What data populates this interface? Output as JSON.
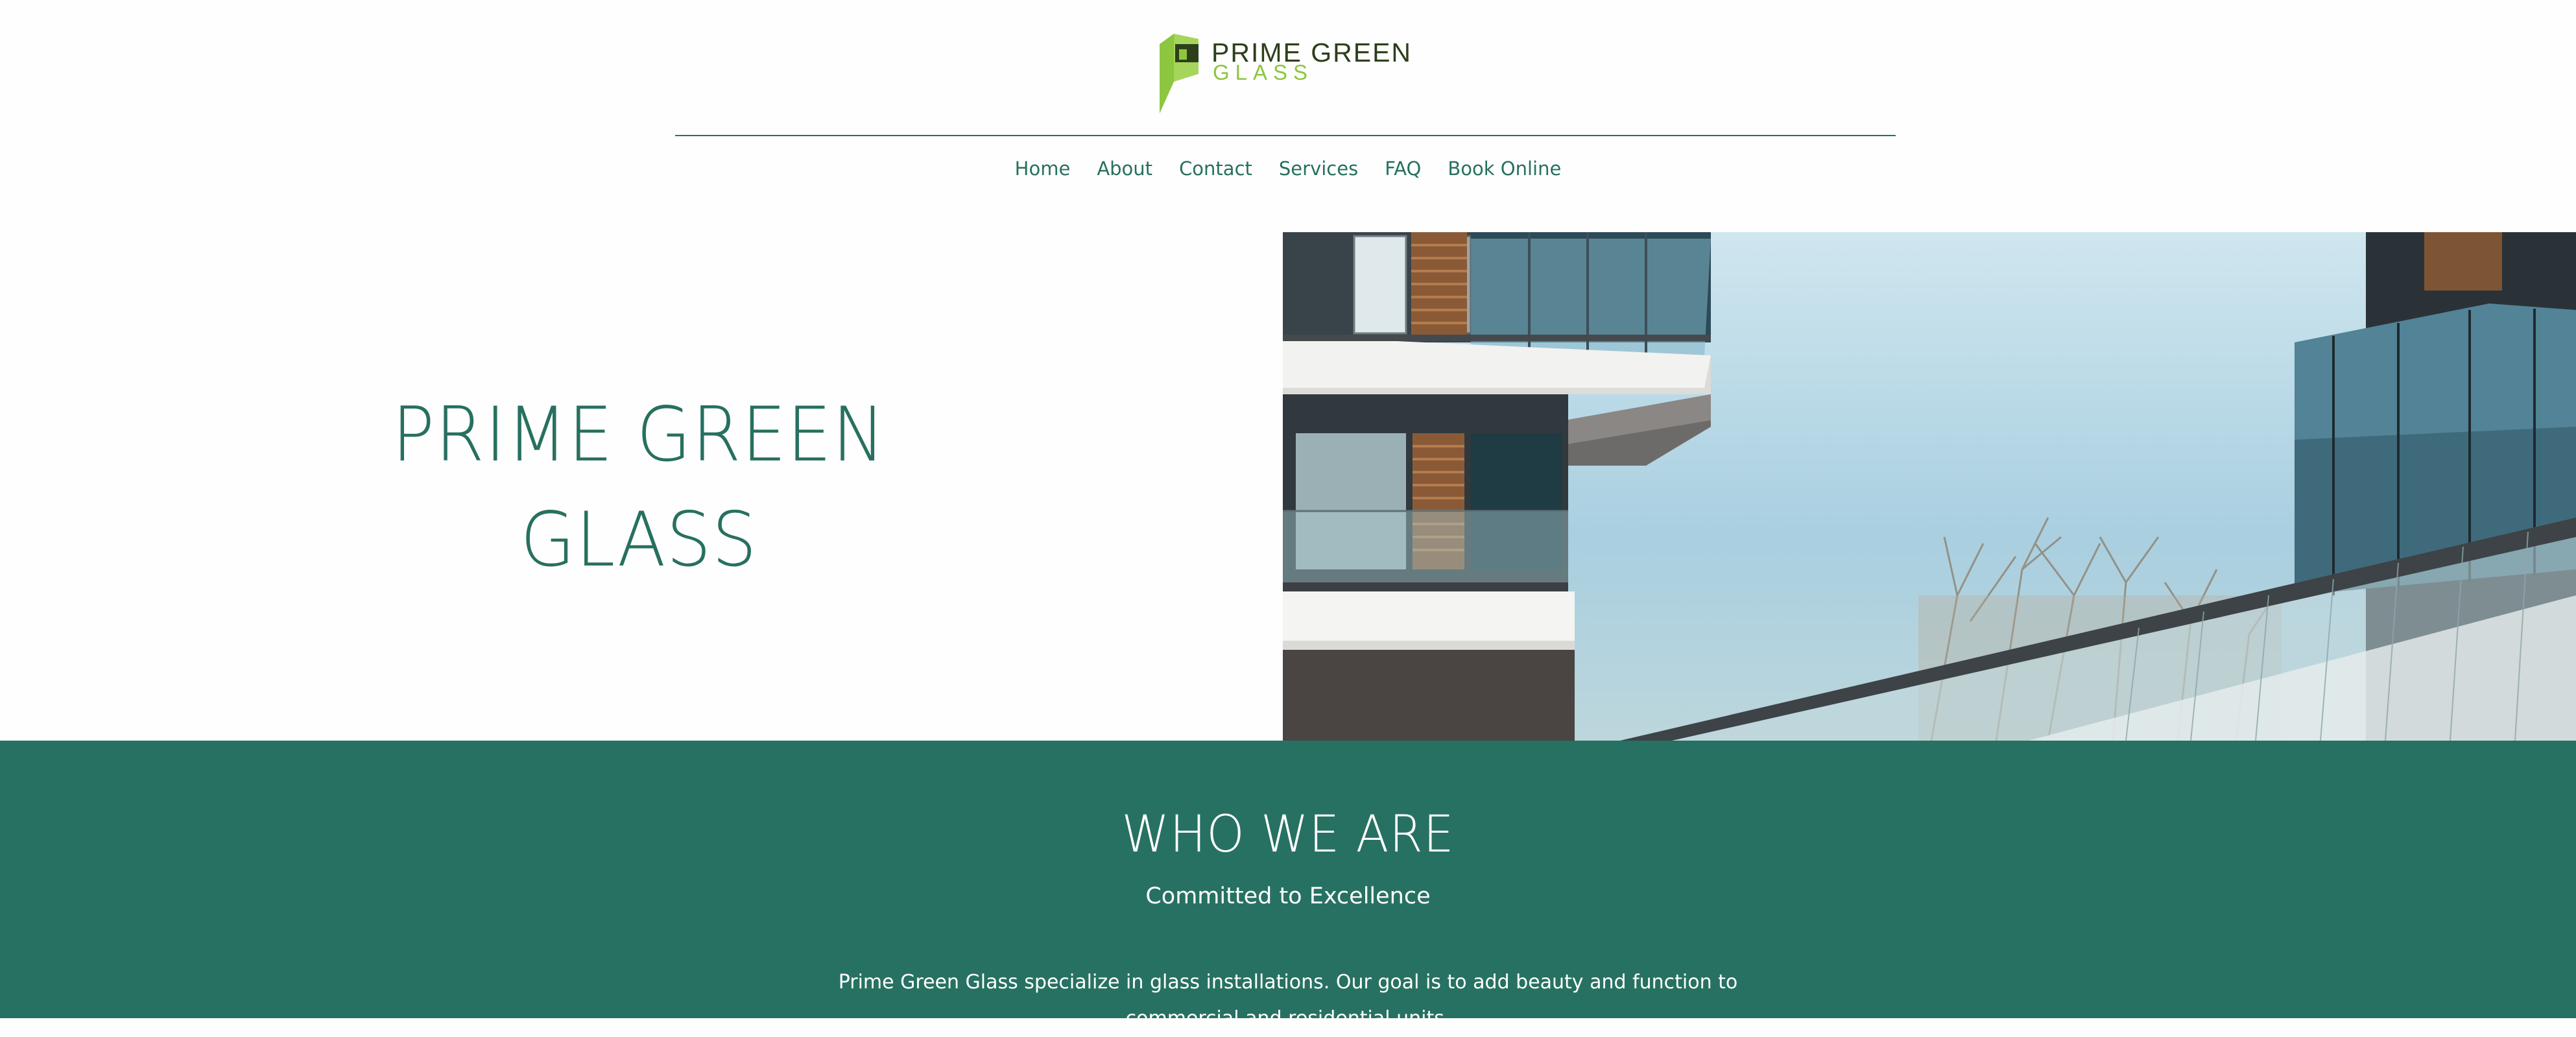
{
  "brand": {
    "line1": "PRIME GREEN",
    "line2": "GLASS",
    "colors": {
      "dark": "#2d3f1a",
      "lime": "#8dc63f",
      "teal": "#27705f"
    }
  },
  "nav": {
    "items": [
      "Home",
      "About",
      "Contact",
      "Services",
      "FAQ",
      "Book Online"
    ]
  },
  "hero": {
    "title_line1": "PRIME GREEN",
    "title_line2": "GLASS"
  },
  "who": {
    "title": "WHO WE ARE",
    "subtitle": "Committed to Excellence",
    "body": "Prime Green Glass specialize in glass installations. Our goal is to add beauty and function to commercial and residential units."
  }
}
